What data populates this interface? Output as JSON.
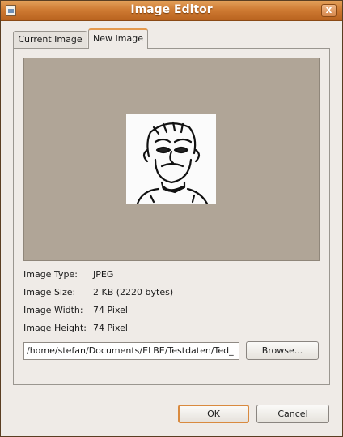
{
  "window": {
    "title": "Image Editor",
    "close_label": "x"
  },
  "tabs": [
    {
      "label": "Current Image",
      "active": false
    },
    {
      "label": "New Image",
      "active": true
    }
  ],
  "info": {
    "type_label": "Image Type:",
    "type_value": "JPEG",
    "size_label": "Image Size:",
    "size_value": "2 KB (2220 bytes)",
    "width_label": "Image Width:",
    "width_value": "74 Pixel",
    "height_label": "Image Height:",
    "height_value": "74 Pixel"
  },
  "path_field": {
    "value": "/home/stefan/Documents/ELBE/Testdaten/Ted_"
  },
  "buttons": {
    "browse": "Browse...",
    "ok": "OK",
    "cancel": "Cancel"
  },
  "colors": {
    "titlebar": "#cf7b33",
    "preview_bg": "#b0a597",
    "accent": "#e49a4e"
  }
}
